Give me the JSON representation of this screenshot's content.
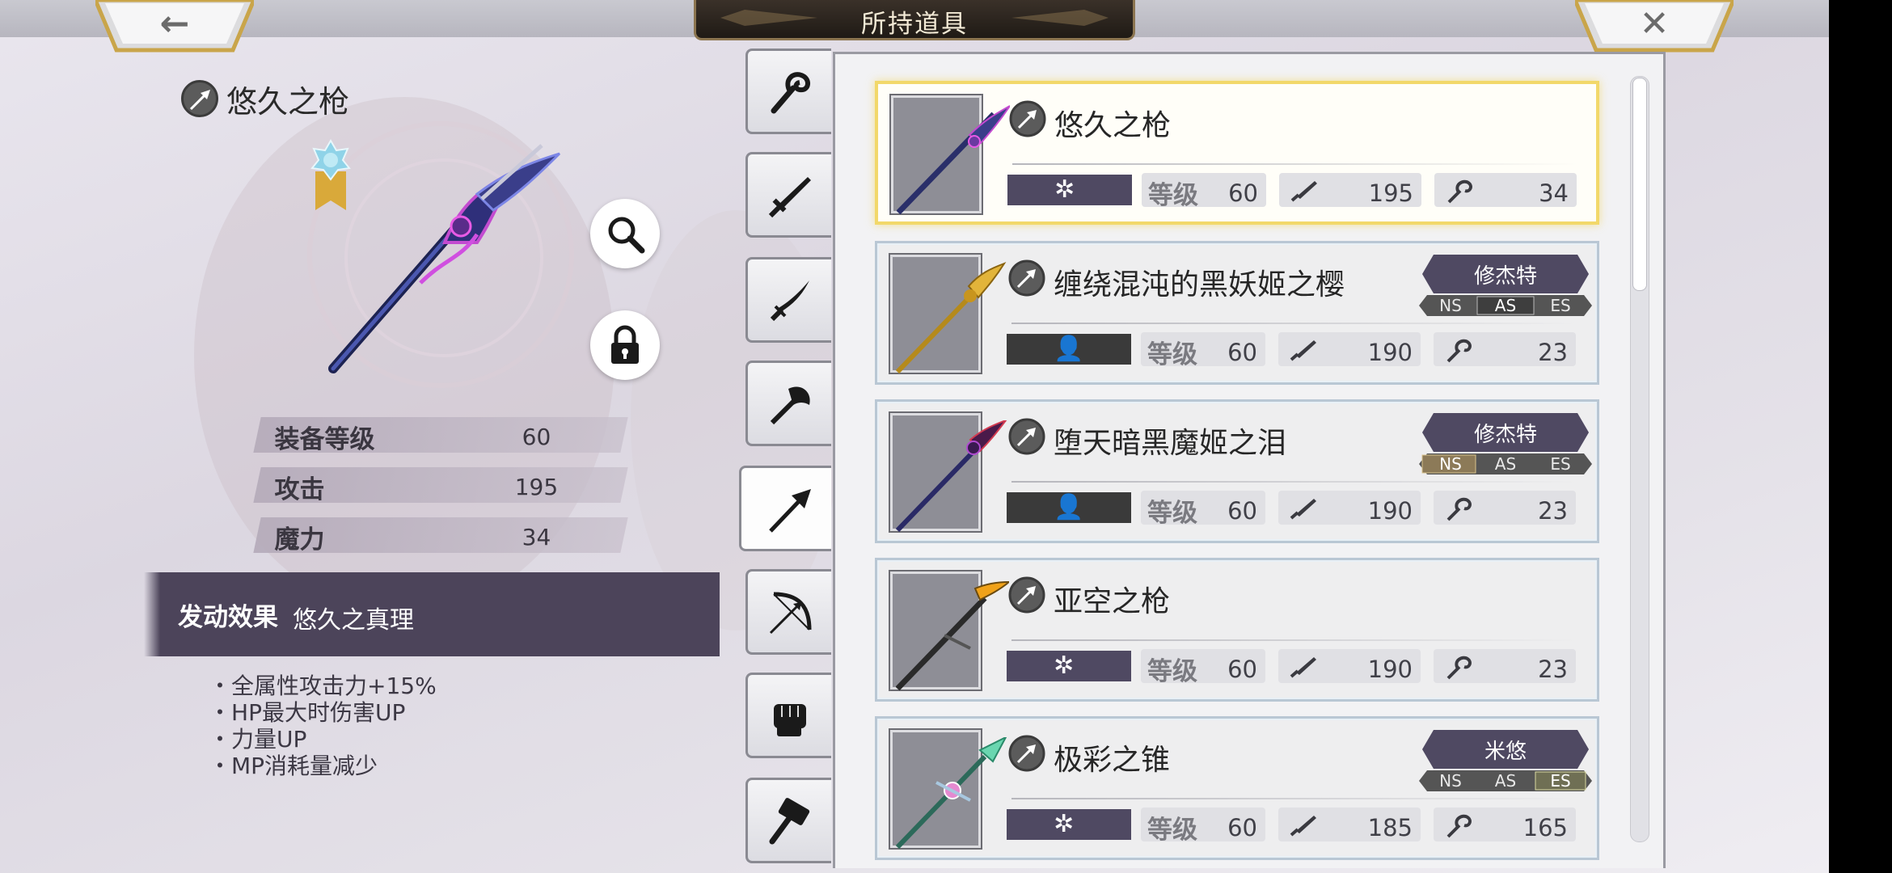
{
  "header": {
    "title": "所持道具",
    "back_glyph": "←",
    "close_glyph": "✕"
  },
  "detail": {
    "weapon_name": "悠久之枪",
    "stats": [
      {
        "label": "装备等级",
        "value": "60"
      },
      {
        "label": "攻击",
        "value": "195"
      },
      {
        "label": "魔力",
        "value": "34"
      }
    ],
    "effect_label": "发动效果",
    "effect_name": "悠久之真理",
    "effects": [
      "全属性攻击力+15%",
      "HP最大时伤害UP",
      "力量UP",
      "MP消耗量减少"
    ]
  },
  "tabs": [
    {
      "name": "staff"
    },
    {
      "name": "sword"
    },
    {
      "name": "katana"
    },
    {
      "name": "axe"
    },
    {
      "name": "spear",
      "active": true
    },
    {
      "name": "bow"
    },
    {
      "name": "gauntlet"
    },
    {
      "name": "hammer"
    }
  ],
  "list": {
    "level_label": "等级",
    "items": [
      {
        "name": "悠久之枪",
        "slot_icon": "✲",
        "slot_type": "element",
        "level": "60",
        "atk": "195",
        "mag": "34",
        "selected": true
      },
      {
        "name": "缠绕混沌的黑妖姬之樱",
        "slot_icon": "👤",
        "slot_type": "character",
        "level": "60",
        "atk": "190",
        "mag": "23",
        "character": "修杰特",
        "modes": [
          "NS",
          "AS",
          "ES"
        ],
        "mode_active": 1
      },
      {
        "name": "堕天暗黑魔姬之泪",
        "slot_icon": "👤",
        "slot_type": "character",
        "level": "60",
        "atk": "190",
        "mag": "23",
        "character": "修杰特",
        "modes": [
          "NS",
          "AS",
          "ES"
        ],
        "mode_active": 0
      },
      {
        "name": "亚空之枪",
        "slot_icon": "✲",
        "slot_type": "element",
        "level": "60",
        "atk": "190",
        "mag": "23"
      },
      {
        "name": "极彩之锥",
        "slot_icon": "✲",
        "slot_type": "element",
        "level": "60",
        "atk": "185",
        "mag": "165",
        "character": "米悠",
        "modes": [
          "NS",
          "AS",
          "ES"
        ],
        "mode_active": 2
      }
    ]
  },
  "colors": {
    "accent_purple": "#4f4962",
    "selected_border": "#f2d86a",
    "gold_trim": "#c9a54a"
  }
}
